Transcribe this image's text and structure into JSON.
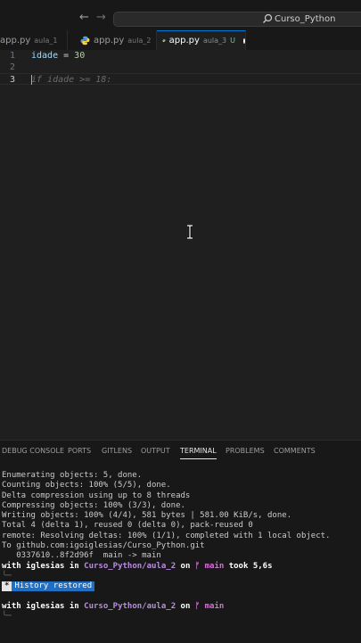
{
  "titlebar": {
    "back_glyph": "←",
    "forward_glyph": "→",
    "command_center_text": "Curso_Python"
  },
  "tabs": [
    {
      "file": "app.py",
      "folder": "aula_1"
    },
    {
      "file": "app.py",
      "folder": "aula_2"
    },
    {
      "file": "app.py",
      "folder": "aula_3",
      "git_status": "U",
      "active": true
    }
  ],
  "editor": {
    "lines": [
      {
        "number": "1",
        "tokens": {
          "var": "idade",
          "op": " = ",
          "num": "30"
        }
      },
      {
        "number": "2"
      },
      {
        "number": "3",
        "ghost": "if idade >= 18:"
      }
    ]
  },
  "panel": {
    "tabs": [
      "DEBUG CONSOLE",
      "PORTS",
      "GITLENS",
      "OUTPUT",
      "TERMINAL",
      "PROBLEMS",
      "COMMENTS"
    ],
    "active_tab": "TERMINAL",
    "terminal": {
      "output_lines": [
        "Enumerating objects: 5, done.",
        "Counting objects: 100% (5/5), done.",
        "Delta compression using up to 8 threads",
        "Compressing objects: 100% (3/3), done.",
        "Writing objects: 100% (4/4), 581 bytes | 581.00 KiB/s, done.",
        "Total 4 (delta 1), reused 0 (delta 0), pack-reused 0",
        "remote: Resolving deltas: 100% (1/1), completed with 1 local object.",
        "To github.com:igoiglesias/Curso_Python.git",
        "   0337610..8f2d96f  main -> main"
      ],
      "prompt1": {
        "with": "with",
        "user": "iglesias",
        "in": "in",
        "dir": "Curso_Python/aula_2",
        "on": "on",
        "branch": "ᚠ main",
        "took": "took",
        "duration": "5,6s"
      },
      "prompt_arrow": "╰─",
      "history_star": "*",
      "history_text": "History restored",
      "prompt2": {
        "with": "with",
        "user": "iglesias",
        "in": "in",
        "dir": "Curso_Python/aula_2",
        "on": "on",
        "branch": "ᚠ main"
      }
    }
  },
  "colors": {
    "accent": "#0078d4",
    "editor_bg": "#1f1f1f",
    "panel_bg": "#181818",
    "untracked": "#73c991"
  }
}
